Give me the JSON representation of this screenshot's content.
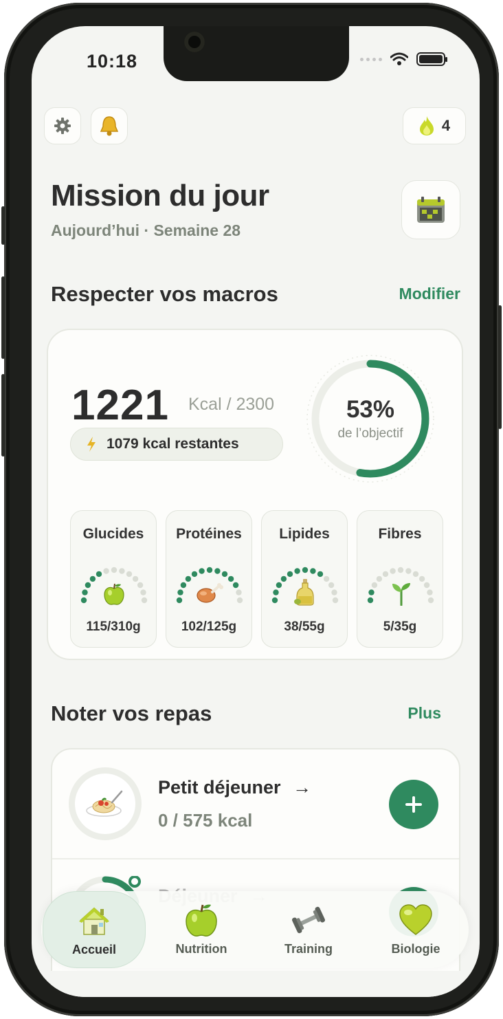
{
  "status": {
    "time": "10:18"
  },
  "header": {
    "streak_count": "4",
    "title": "Mission du jour",
    "subtitle": "Aujourd’hui · Semaine 28"
  },
  "macros_section": {
    "title": "Respecter vos macros",
    "action": "Modifier"
  },
  "calories": {
    "consumed": "1221",
    "goal_text": "Kcal / 2300",
    "remaining_text": "1079 kcal restantes",
    "progress_percent": 53,
    "progress_text": "53%",
    "progress_label": "de l’objectif"
  },
  "macros": [
    {
      "name": "Glucides",
      "value_text": "115/310g",
      "progress": 0.37,
      "icon": "apple-icon"
    },
    {
      "name": "Protéines",
      "value_text": "102/125g",
      "progress": 0.82,
      "icon": "chicken-leg-icon"
    },
    {
      "name": "Lipides",
      "value_text": "38/55g",
      "progress": 0.69,
      "icon": "oil-bottle-icon"
    },
    {
      "name": "Fibres",
      "value_text": "5/35g",
      "progress": 0.14,
      "icon": "sprout-icon"
    }
  ],
  "meals_section": {
    "title": "Noter vos repas",
    "action": "Plus"
  },
  "meals": [
    {
      "name": "Petit déjeuner",
      "kcal_text": "0 / 575 kcal"
    },
    {
      "name": "Déjeuner"
    }
  ],
  "nav": [
    {
      "label": "Accueil",
      "icon": "house-icon",
      "active": true
    },
    {
      "label": "Nutrition",
      "icon": "apple-icon"
    },
    {
      "label": "Training",
      "icon": "dumbbell-icon"
    },
    {
      "label": "Biologie",
      "icon": "heart-icon"
    }
  ],
  "colors": {
    "accent": "#2f8a5f",
    "background": "#f4f5f2",
    "ring_track": "#eceee8",
    "gauge_empty": "#d9dcd4"
  }
}
